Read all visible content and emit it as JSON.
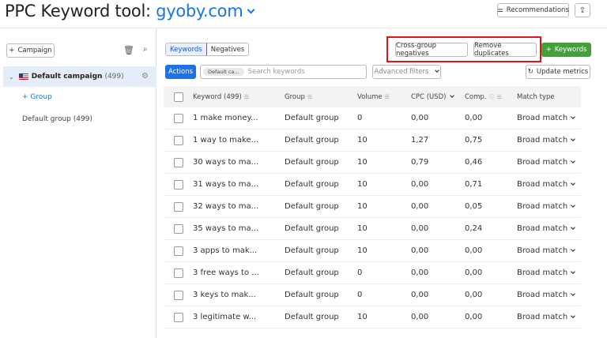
{
  "header": {
    "title_prefix": "PPC Keyword tool:",
    "domain": "gyoby.com",
    "recommendations_label": "Recommendations"
  },
  "sidebar": {
    "add_campaign_label": "Campaign",
    "campaign": {
      "name": "Default campaign",
      "count": "(499)"
    },
    "add_group_label": "Group",
    "groups": [
      {
        "label": "Default group (499)"
      }
    ]
  },
  "toolbar": {
    "tabs": [
      {
        "label": "Keywords",
        "active": true
      },
      {
        "label": "Negatives",
        "active": false
      }
    ],
    "cross_group_label": "Cross-group negatives",
    "remove_duplicates_label": "Remove duplicates",
    "add_keywords_label": "Keywords",
    "actions_label": "Actions",
    "filter_chip": "Default ca...",
    "search_placeholder": "Search keywords",
    "advanced_filters_label": "Advanced filters",
    "update_metrics_label": "Update metrics"
  },
  "colors": {
    "accent": "#1a73e8",
    "green": "#3fa33a",
    "highlight": "#e1141e"
  },
  "table": {
    "columns": [
      "Keyword (499)",
      "Group",
      "Volume",
      "CPC (USD)",
      "Comp.",
      "Match type"
    ],
    "rows": [
      {
        "keyword": "1 make money...",
        "group": "Default group",
        "volume": "0",
        "cpc": "0,00",
        "comp": "0,00",
        "match": "Broad match"
      },
      {
        "keyword": "1 way to make...",
        "group": "Default group",
        "volume": "10",
        "cpc": "1,27",
        "comp": "0,75",
        "match": "Broad match"
      },
      {
        "keyword": "30 ways to ma...",
        "group": "Default group",
        "volume": "10",
        "cpc": "0,79",
        "comp": "0,46",
        "match": "Broad match"
      },
      {
        "keyword": "31 ways to ma...",
        "group": "Default group",
        "volume": "10",
        "cpc": "0,00",
        "comp": "0,71",
        "match": "Broad match"
      },
      {
        "keyword": "32 ways to ma...",
        "group": "Default group",
        "volume": "10",
        "cpc": "0,00",
        "comp": "0,05",
        "match": "Broad match"
      },
      {
        "keyword": "35 ways to ma...",
        "group": "Default group",
        "volume": "10",
        "cpc": "0,00",
        "comp": "0,24",
        "match": "Broad match"
      },
      {
        "keyword": "3 apps to mak...",
        "group": "Default group",
        "volume": "10",
        "cpc": "0,00",
        "comp": "0,00",
        "match": "Broad match"
      },
      {
        "keyword": "3 free ways to ...",
        "group": "Default group",
        "volume": "0",
        "cpc": "0,00",
        "comp": "0,00",
        "match": "Broad match"
      },
      {
        "keyword": "3 keys to mak...",
        "group": "Default group",
        "volume": "0",
        "cpc": "0,00",
        "comp": "0,00",
        "match": "Broad match"
      },
      {
        "keyword": "3 legitimate w...",
        "group": "Default group",
        "volume": "10",
        "cpc": "0,00",
        "comp": "0,00",
        "match": "Broad match"
      }
    ]
  }
}
